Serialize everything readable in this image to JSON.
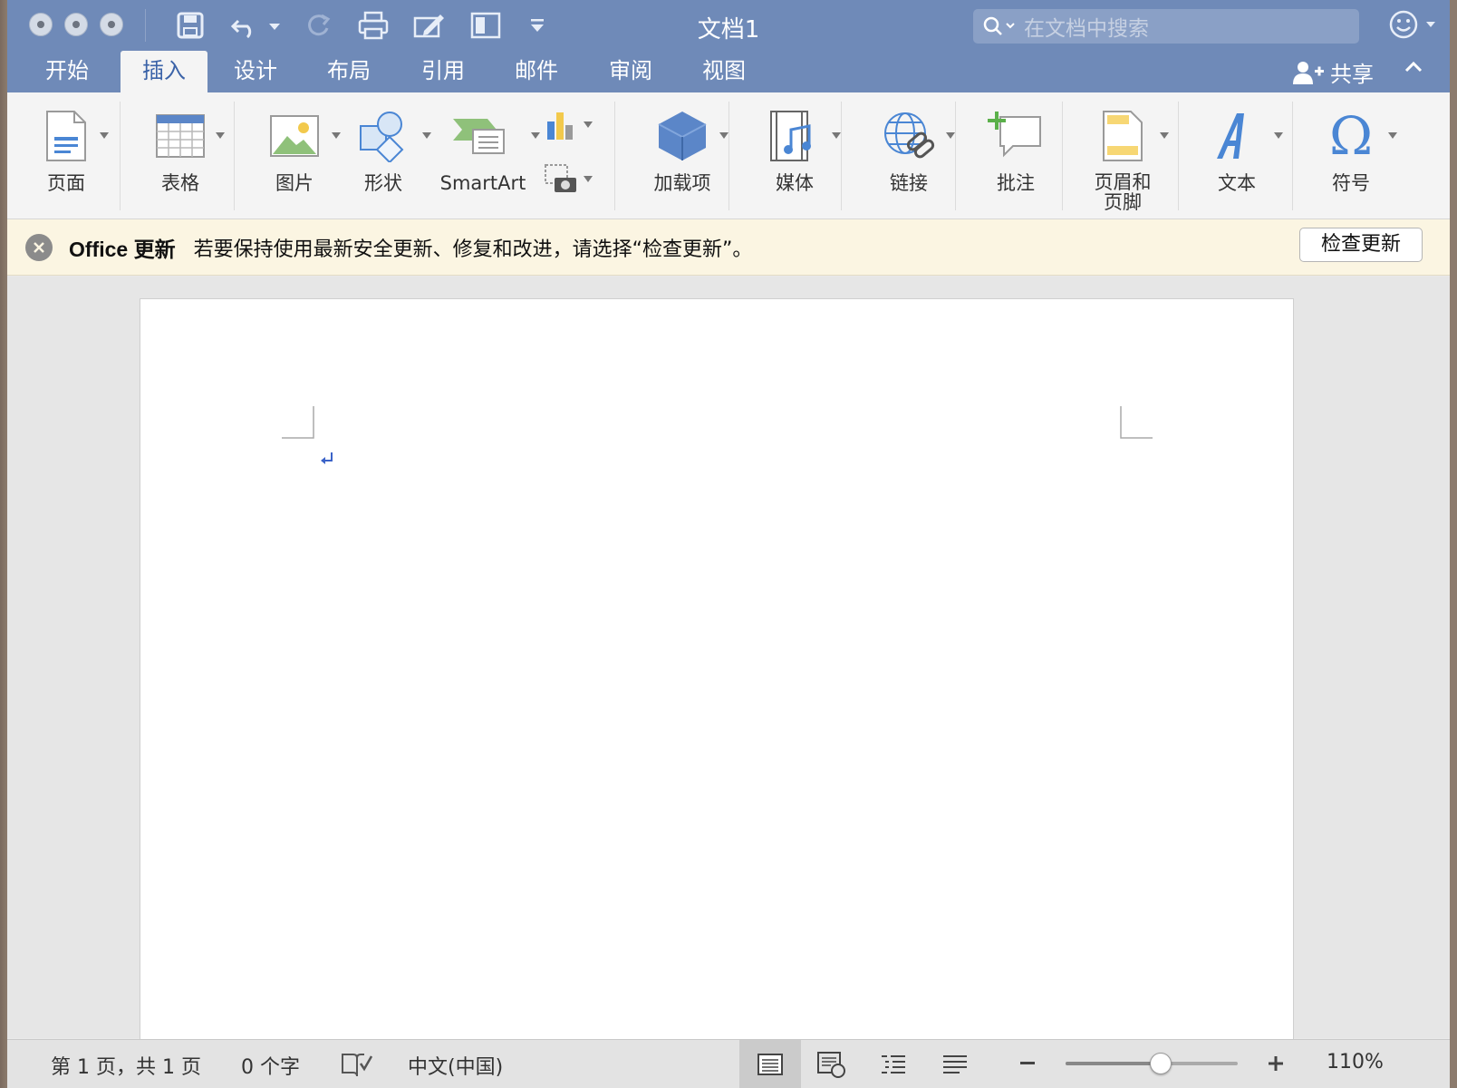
{
  "window": {
    "title": "文档1",
    "search_placeholder": "在文档中搜索"
  },
  "tabs": [
    {
      "label": "开始"
    },
    {
      "label": "插入",
      "active": true
    },
    {
      "label": "设计"
    },
    {
      "label": "布局"
    },
    {
      "label": "引用"
    },
    {
      "label": "邮件"
    },
    {
      "label": "审阅"
    },
    {
      "label": "视图"
    }
  ],
  "share_label": "共享",
  "ribbon": {
    "page": "页面",
    "table": "表格",
    "picture": "图片",
    "shapes": "形状",
    "smartart": "SmartArt",
    "addins": "加载项",
    "media": "媒体",
    "link": "链接",
    "comment": "批注",
    "header_footer_line1": "页眉和",
    "header_footer_line2": "页脚",
    "text": "文本",
    "symbol": "符号"
  },
  "notice": {
    "title": "Office 更新",
    "message": "若要保持使用最新安全更新、修复和改进，请选择“检查更新”。",
    "button": "检查更新"
  },
  "status": {
    "page_info": "第 1 页，共 1 页",
    "word_count": "0 个字",
    "language": "中文(中国)",
    "zoom": "110%",
    "zoom_fraction": 0.55
  },
  "colors": {
    "titlebar": "#6f8ab8",
    "accent": "#3b63a8",
    "notice_bg": "#fbf5e2"
  }
}
